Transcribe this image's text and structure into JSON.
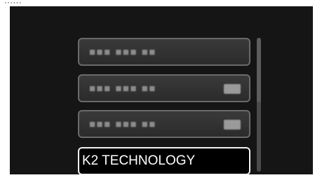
{
  "caption": "······",
  "menu": {
    "items": [
      {
        "text": "■■■ ■■■ ■■",
        "badge": false,
        "selected": false
      },
      {
        "text": "■■■ ■■■ ■■",
        "badge": true,
        "selected": false
      },
      {
        "text": "■■■ ■■■ ■■",
        "badge": true,
        "selected": false
      },
      {
        "text": "K2 TECHNOLOGY",
        "badge": false,
        "selected": true
      }
    ]
  },
  "colors": {
    "screen_bg": "#151515",
    "item_border": "#6a6a6a",
    "selected_border": "#f2f2f2",
    "selected_text": "#ffffff"
  }
}
